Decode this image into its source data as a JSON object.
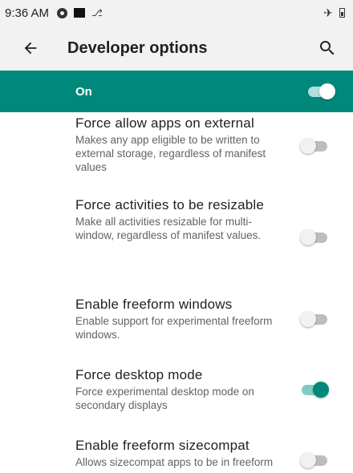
{
  "status_bar": {
    "time": "9:36 AM",
    "icons": [
      "data-saver-icon",
      "notification-square-icon",
      "usb-icon",
      "airplane-icon",
      "battery-icon"
    ]
  },
  "app_bar": {
    "title": "Developer options",
    "back_icon": "arrow-back-icon",
    "search_icon": "search-icon"
  },
  "master": {
    "label": "On",
    "checked": true
  },
  "colors": {
    "accent": "#00897b",
    "accent_track": "#80cbc4",
    "status_bg": "#f2f2f2"
  },
  "preferences": [
    {
      "title": "Force allow apps on external",
      "summary": "Makes any app eligible to be written to external storage, regardless of manifest values",
      "checked": false
    },
    {
      "title": "Force activities to be resizable",
      "summary": "Make all activities resizable for multi-window, regardless of manifest values.",
      "checked": false
    },
    {
      "title": "Enable freeform windows",
      "summary": "Enable support for experimental freeform windows.",
      "checked": false
    },
    {
      "title": "Force desktop mode",
      "summary": "Force experimental desktop mode on secondary displays",
      "checked": true
    },
    {
      "title": "Enable freeform sizecompat",
      "summary": "Allows sizecompat apps to be in freeform",
      "checked": false
    }
  ]
}
